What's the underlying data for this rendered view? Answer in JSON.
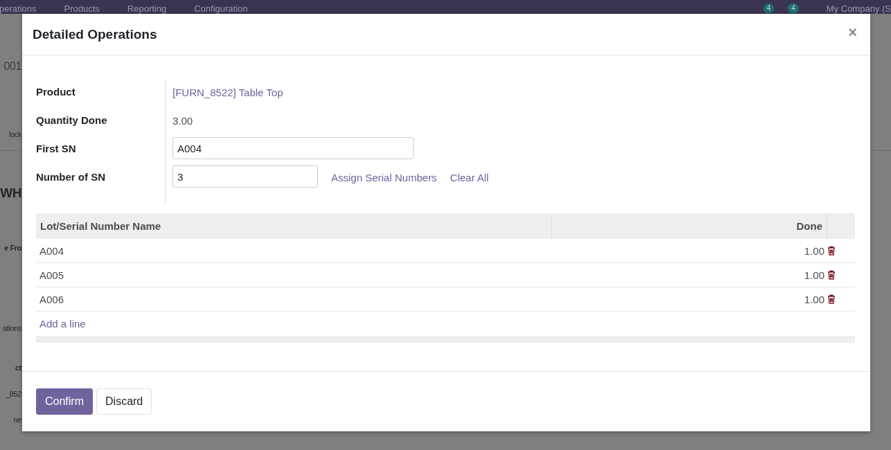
{
  "navbar": {
    "menu": [
      "perations",
      "Products",
      "Reporting",
      "Configuration"
    ],
    "badges": [
      "4",
      "4"
    ],
    "company": "My Company (S"
  },
  "background_fragments": [
    {
      "text": "001",
      "kind": "title"
    },
    {
      "text": "lock",
      "kind": "plain"
    },
    {
      "text": "WH",
      "kind": "heading"
    },
    {
      "text": "e Fro",
      "kind": "label"
    },
    {
      "text": "ations",
      "kind": "plain"
    },
    {
      "text": "ct",
      "kind": "label"
    },
    {
      "text": "_852",
      "kind": "plain"
    },
    {
      "text": "ne",
      "kind": "plain"
    }
  ],
  "dialog": {
    "title": "Detailed Operations",
    "close": "×",
    "fields": [
      {
        "label": "Product",
        "kind": "link",
        "value": "[FURN_8522] Table Top"
      },
      {
        "label": "Quantity Done",
        "kind": "text",
        "value": "3.00"
      },
      {
        "label": "First SN",
        "kind": "input",
        "value": "A004"
      },
      {
        "label": "Number of SN",
        "kind": "input",
        "value": "3",
        "actions": [
          "Assign Serial Numbers",
          "Clear All"
        ]
      }
    ],
    "table": {
      "columns": [
        "Lot/Serial Number Name",
        "Done"
      ],
      "rows": [
        {
          "name": "A004",
          "done": "1.00"
        },
        {
          "name": "A005",
          "done": "1.00"
        },
        {
          "name": "A006",
          "done": "1.00"
        }
      ],
      "add_line": "Add a line"
    },
    "buttons": [
      {
        "label": "Confirm",
        "kind": "primary"
      },
      {
        "label": "Discard",
        "kind": "secondary"
      }
    ]
  }
}
